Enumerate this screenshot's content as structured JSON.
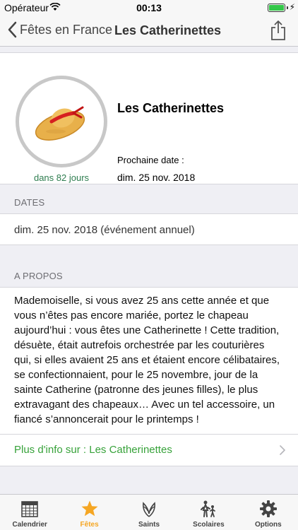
{
  "status": {
    "carrier": "Opérateur",
    "time": "00:13"
  },
  "nav": {
    "back_label": "Fêtes en France",
    "title": "Les Catherinettes"
  },
  "event": {
    "name": "Les Catherinettes",
    "countdown": "dans 82 jours",
    "next_label": "Prochaine date :",
    "next_date": "dim. 25 nov. 2018"
  },
  "dates": {
    "header": "DATES",
    "entry": "dim. 25 nov. 2018 (événement annuel)"
  },
  "about": {
    "header": "A PROPOS",
    "text": "Mademoiselle, si vous avez 25 ans cette année et que vous n’êtes pas encore mariée, portez le chapeau aujourd’hui : vous êtes une Catherinette ! Cette tradition, désuète, était autrefois orchestrée par les couturières qui, si elles avaient 25 ans et étaient encore célibataires, se confectionnaient, pour le 25 novembre, jour de la sainte Catherine (patronne des jeunes filles), le plus extravagant des chapeaux… Avec un tel accessoire, un fiancé s’annoncerait pour le printemps !",
    "more_link": "Plus d'info sur : Les Catherinettes"
  },
  "tabs": [
    {
      "label": "Calendrier",
      "icon": "calendar-icon"
    },
    {
      "label": "Fêtes",
      "icon": "star-icon",
      "active": true
    },
    {
      "label": "Saints",
      "icon": "laurel-icon"
    },
    {
      "label": "Scolaires",
      "icon": "school-icon"
    },
    {
      "label": "Options",
      "icon": "gear-icon"
    }
  ],
  "colors": {
    "accent": "#f5a623",
    "link": "#37a23a",
    "countdown": "#2e7d4f"
  }
}
